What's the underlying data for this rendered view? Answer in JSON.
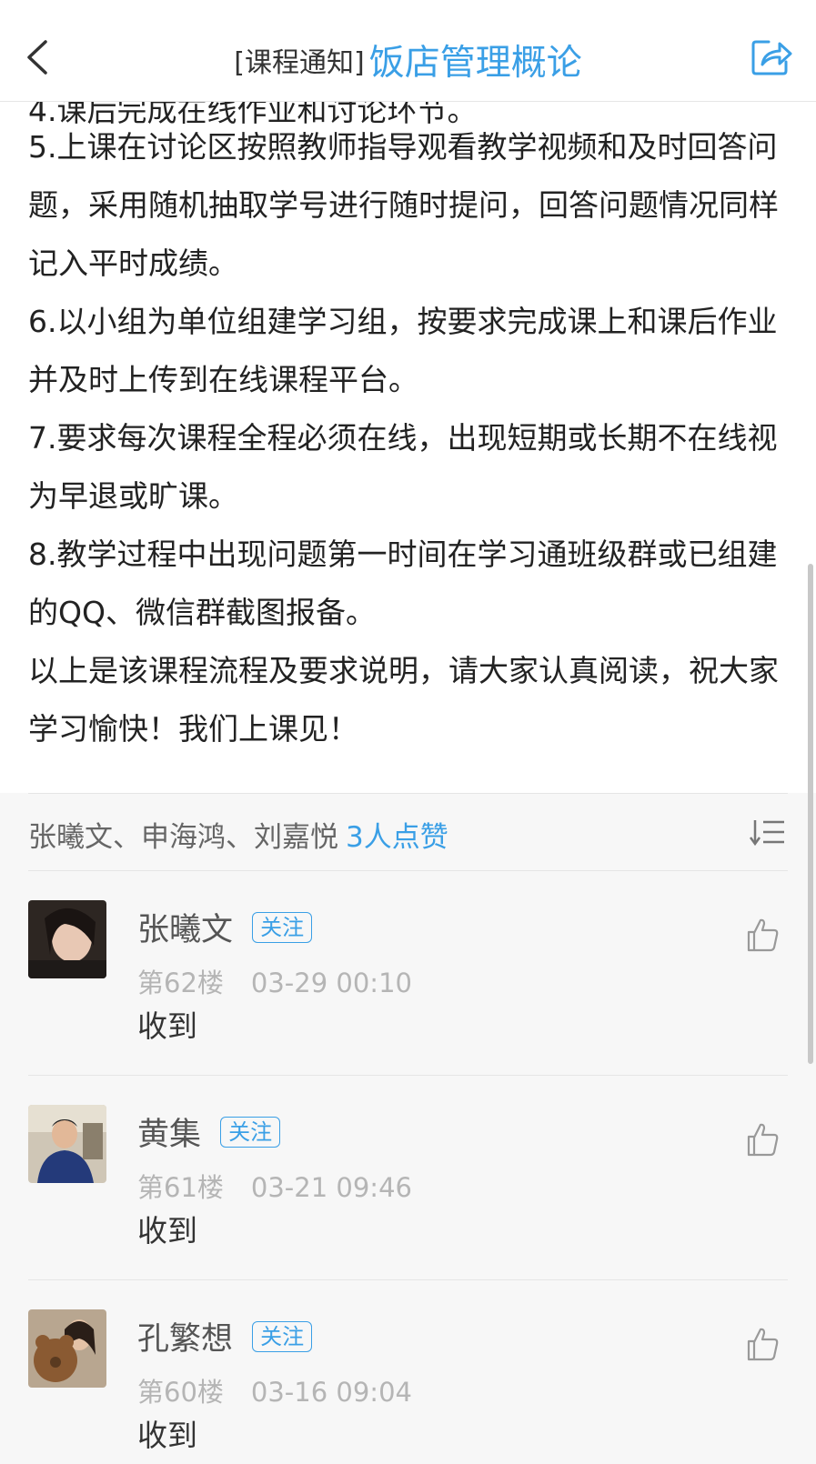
{
  "header": {
    "prefix": "[课程通知]",
    "title": "饭店管理概论",
    "back_icon": "chevron-left-icon",
    "share_icon": "share-icon"
  },
  "content": {
    "cut_off_line": "4.课后完成在线作业和讨论环节。",
    "paragraphs": [
      "5.上课在讨论区按照教师指导观看教学视频和及时回答问题，采用随机抽取学号进行随时提问，回答问题情况同样记入平时成绩。",
      "6.以小组为单位组建学习组，按要求完成课上和课后作业并及时上传到在线课程平台。",
      "7.要求每次课程全程必须在线，出现短期或长期不在线视为早退或旷课。",
      "8.教学过程中出现问题第一时间在学习通班级群或已组建的QQ、微信群截图报备。",
      "以上是该课程流程及要求说明，请大家认真阅读，祝大家学习愉快！我们上课见！"
    ]
  },
  "likes": {
    "names": "张曦文、申海鸿、刘嘉悦",
    "count": "3人点赞",
    "sort_icon": "sort-icon"
  },
  "comments": [
    {
      "name": "张曦文",
      "follow": "关注",
      "floor": "第62楼",
      "time": "03-29 00:10",
      "text": "收到"
    },
    {
      "name": "黄集",
      "follow": "关注",
      "floor": "第61楼",
      "time": "03-21 09:46",
      "text": "收到"
    },
    {
      "name": "孔繁想",
      "follow": "关注",
      "floor": "第60楼",
      "time": "03-16 09:04",
      "text": "收到"
    }
  ],
  "colors": {
    "accent": "#3a9fe6",
    "muted": "#b5b5b5",
    "lower_bg": "#f7f7f7"
  }
}
